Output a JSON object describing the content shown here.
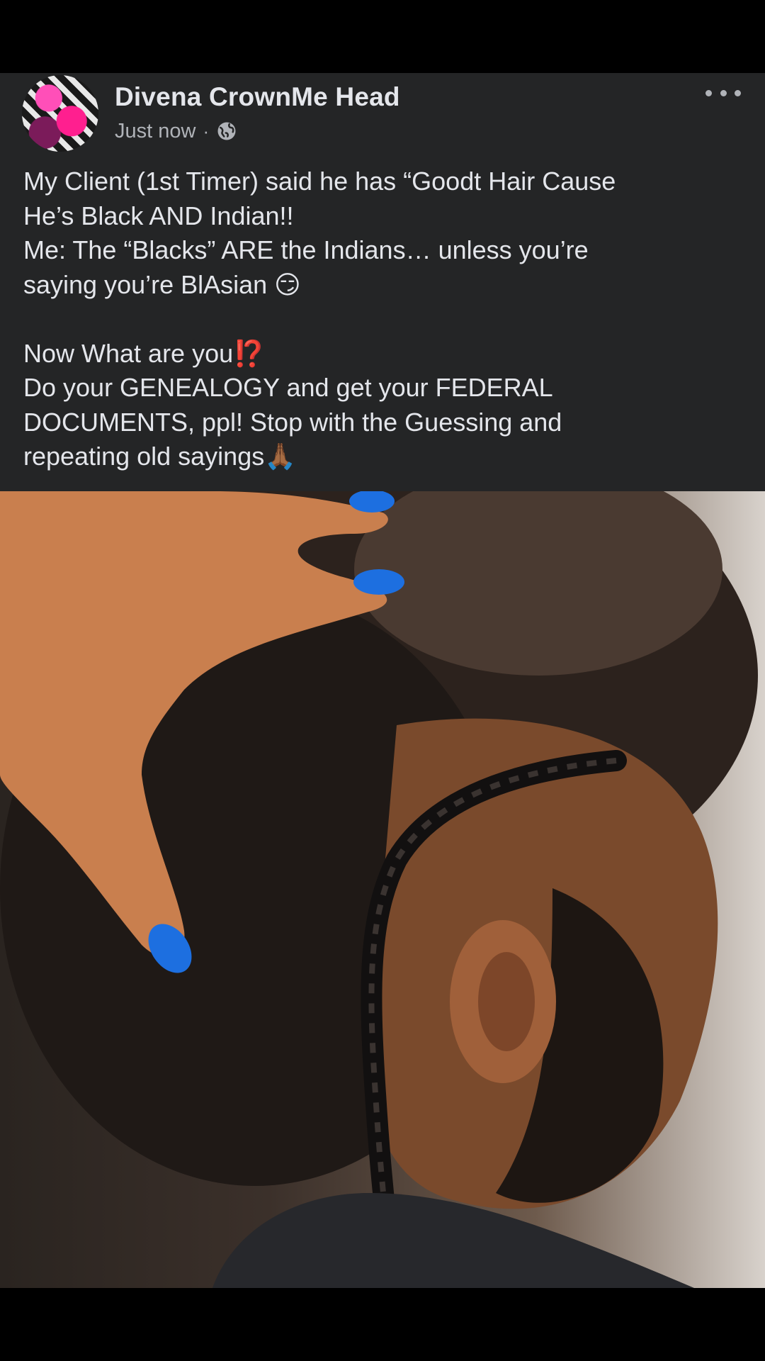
{
  "post": {
    "author": "Divena CrownMe Head",
    "time": "Just now",
    "separator": "·",
    "audience_icon": "globe-icon",
    "more_icon": "more-dots-icon",
    "lines": [
      "My Client (1st Timer) said he has “Goodt Hair Cause",
      "He’s Black AND Indian!!",
      "Me: The “Blacks” ARE the Indians… unless you’re",
      "saying you’re BlAsian 😏",
      "",
      "Now What are you⁉️",
      "Do your GENEALOGY and get your FEDERAL",
      "DOCUMENTS, ppl! Stop with the Guessing and",
      "repeating old sayings🙏🏾"
    ]
  },
  "photo": {
    "description_icon": "photo-braided-hair"
  }
}
